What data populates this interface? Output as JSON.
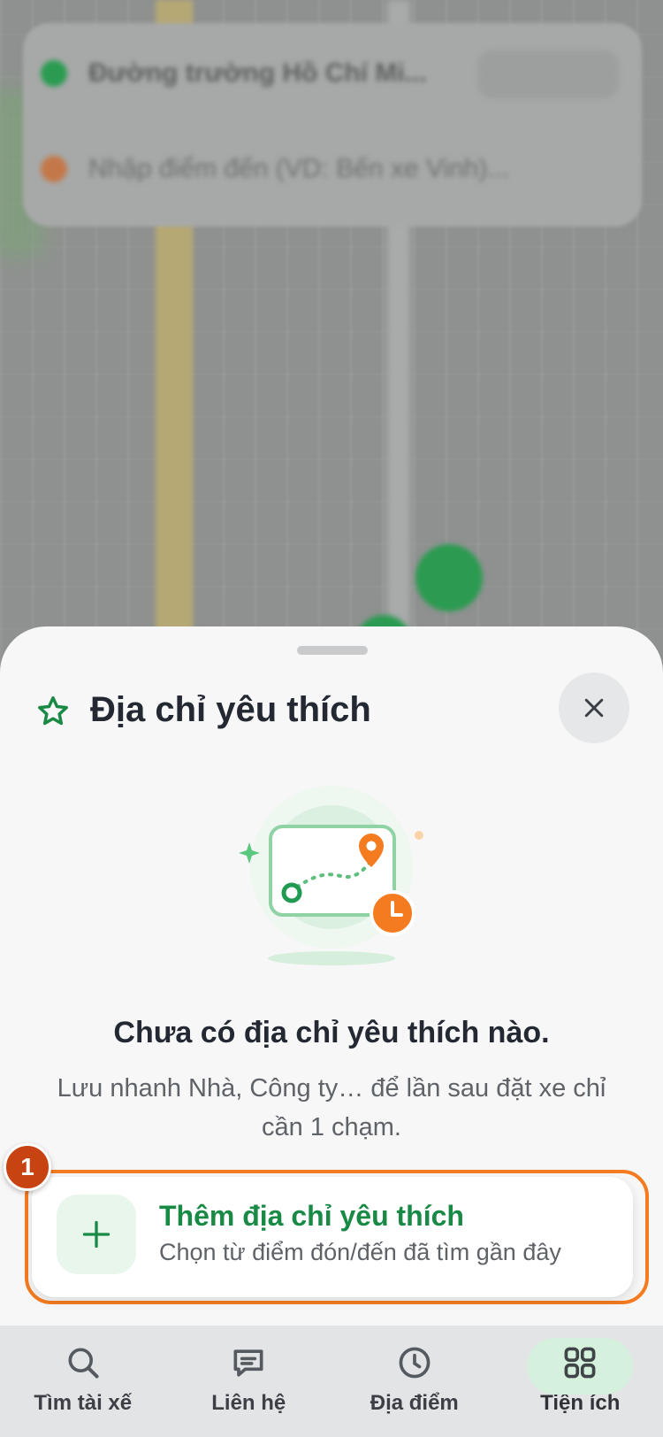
{
  "map": {
    "origin_text": "Đường trường Hồ Chí Mi...",
    "destination_text": "Nhập điểm đến (VD: Bến xe Vinh)..."
  },
  "sheet": {
    "title": "Địa chỉ yêu thích",
    "empty_title": "Chưa có địa chỉ yêu thích nào.",
    "empty_desc": "Lưu nhanh Nhà, Công ty… để lần sau đặt xe chỉ cần 1 chạm.",
    "add_title": "Thêm địa chỉ yêu thích",
    "add_subtitle": "Chọn từ điểm đón/đến đã tìm gần đây",
    "step_badge": "1"
  },
  "nav": {
    "items": [
      {
        "label": "Tìm tài xế",
        "icon": "search-icon"
      },
      {
        "label": "Liên hệ",
        "icon": "chat-icon"
      },
      {
        "label": "Địa điểm",
        "icon": "clock-icon"
      },
      {
        "label": "Tiện ích",
        "icon": "grid-icon",
        "active": true
      }
    ]
  },
  "colors": {
    "brand_green": "#198a46",
    "accent_orange": "#f47b20",
    "active_pill": "#d5f0dc"
  }
}
